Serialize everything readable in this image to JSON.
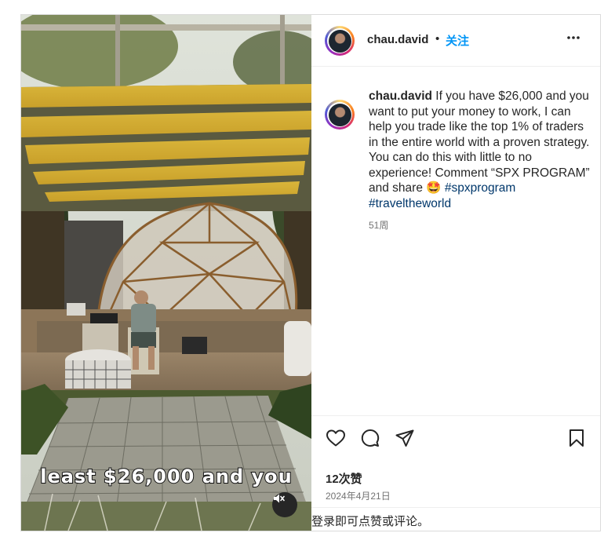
{
  "post": {
    "username": "chau.david",
    "separator": "•",
    "follow_label": "关注",
    "more_icon": "more-horizontal-icon"
  },
  "caption": {
    "username": "chau.david",
    "text": "If you have $26,000 and you want to put your money to work, I can help you trade like the top 1% of traders in the entire world with a proven strategy. You can do this with little to no experience! Comment “SPX PROGRAM” and share 🤩",
    "hashtag_1": "#spxprogram",
    "hashtag_2": "#traveltheworld",
    "time_ago": "51周"
  },
  "media": {
    "overlay_text": "least $26,000 and you",
    "mute_icon": "speaker-muted-icon"
  },
  "actions": {
    "like_icon": "heart-icon",
    "comment_icon": "comment-icon",
    "share_icon": "paper-plane-icon",
    "save_icon": "bookmark-icon",
    "likes_text": "12次赞",
    "date_text": "2024年4月21日"
  },
  "footer": {
    "login_link": "登录",
    "login_rest": "即可点赞或评论。"
  }
}
